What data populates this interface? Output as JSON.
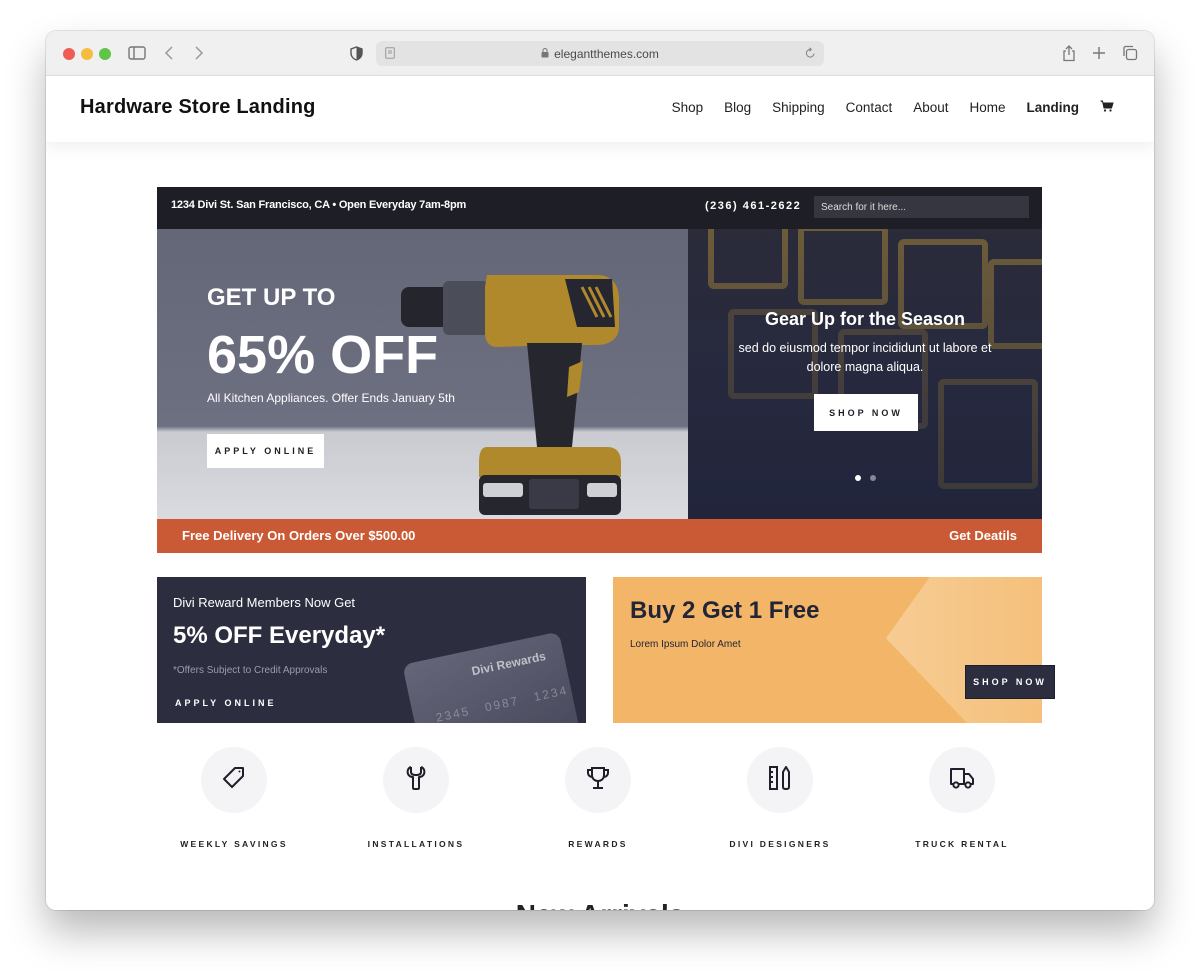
{
  "browser": {
    "url": "elegantthemes.com",
    "icons": [
      "sidebar-toggle-icon",
      "back-icon",
      "forward-icon",
      "privacy-shield-icon",
      "reader-icon",
      "lock-icon",
      "reload-icon",
      "share-icon",
      "new-tab-icon",
      "tabs-overview-icon"
    ]
  },
  "header": {
    "logo": "Hardware Store Landing",
    "nav": [
      {
        "label": "Shop"
      },
      {
        "label": "Blog"
      },
      {
        "label": "Shipping"
      },
      {
        "label": "Contact"
      },
      {
        "label": "About"
      },
      {
        "label": "Home"
      },
      {
        "label": "Landing",
        "active": true
      }
    ],
    "cart_icon": "cart-icon"
  },
  "topbar": {
    "address": "1234 Divi St. San Francisco, CA • Open Everyday 7am-8pm",
    "phone": "(236) 461-2622",
    "search_placeholder": "Search for it here..."
  },
  "hero_left": {
    "kicker": "GET UP TO",
    "headline": "65% OFF",
    "subtext": "All Kitchen Appliances. Offer Ends January 5th",
    "button": "APPLY ONLINE"
  },
  "hero_right": {
    "title": "Gear Up for the Season",
    "description": "sed do eiusmod tempor incididunt ut labore et dolore magna aliqua.",
    "button": "SHOP NOW",
    "slides": 2,
    "active_slide": 1
  },
  "delivery_bar": {
    "text": "Free Delivery On Orders Over $500.00",
    "link": "Get Deatils"
  },
  "promo_rewards": {
    "line1": "Divi Reward Members Now Get",
    "headline": "5% OFF Everyday*",
    "note": "*Offers Subject to Credit Approvals",
    "link": "APPLY ONLINE",
    "card_name": "Divi Rewards",
    "card_number": "2345 0987 1234"
  },
  "promo_bogo": {
    "headline": "Buy 2 Get 1 Free",
    "subtext": "Lorem Ipsum Dolor Amet",
    "button": "SHOP NOW"
  },
  "features": [
    {
      "label": "WEEKLY SAVINGS",
      "icon": "tag-icon"
    },
    {
      "label": "INSTALLATIONS",
      "icon": "wrench-icon"
    },
    {
      "label": "REWARDS",
      "icon": "trophy-icon"
    },
    {
      "label": "DIVI DESIGNERS",
      "icon": "ruler-pencil-icon"
    },
    {
      "label": "TRUCK RENTAL",
      "icon": "truck-icon"
    }
  ],
  "section_heading": "New Arrivals",
  "colors": {
    "dark": "#1e1f26",
    "navy": "#2c2d3e",
    "accent_orange": "#c95a35",
    "promo_orange": "#f3b567"
  }
}
